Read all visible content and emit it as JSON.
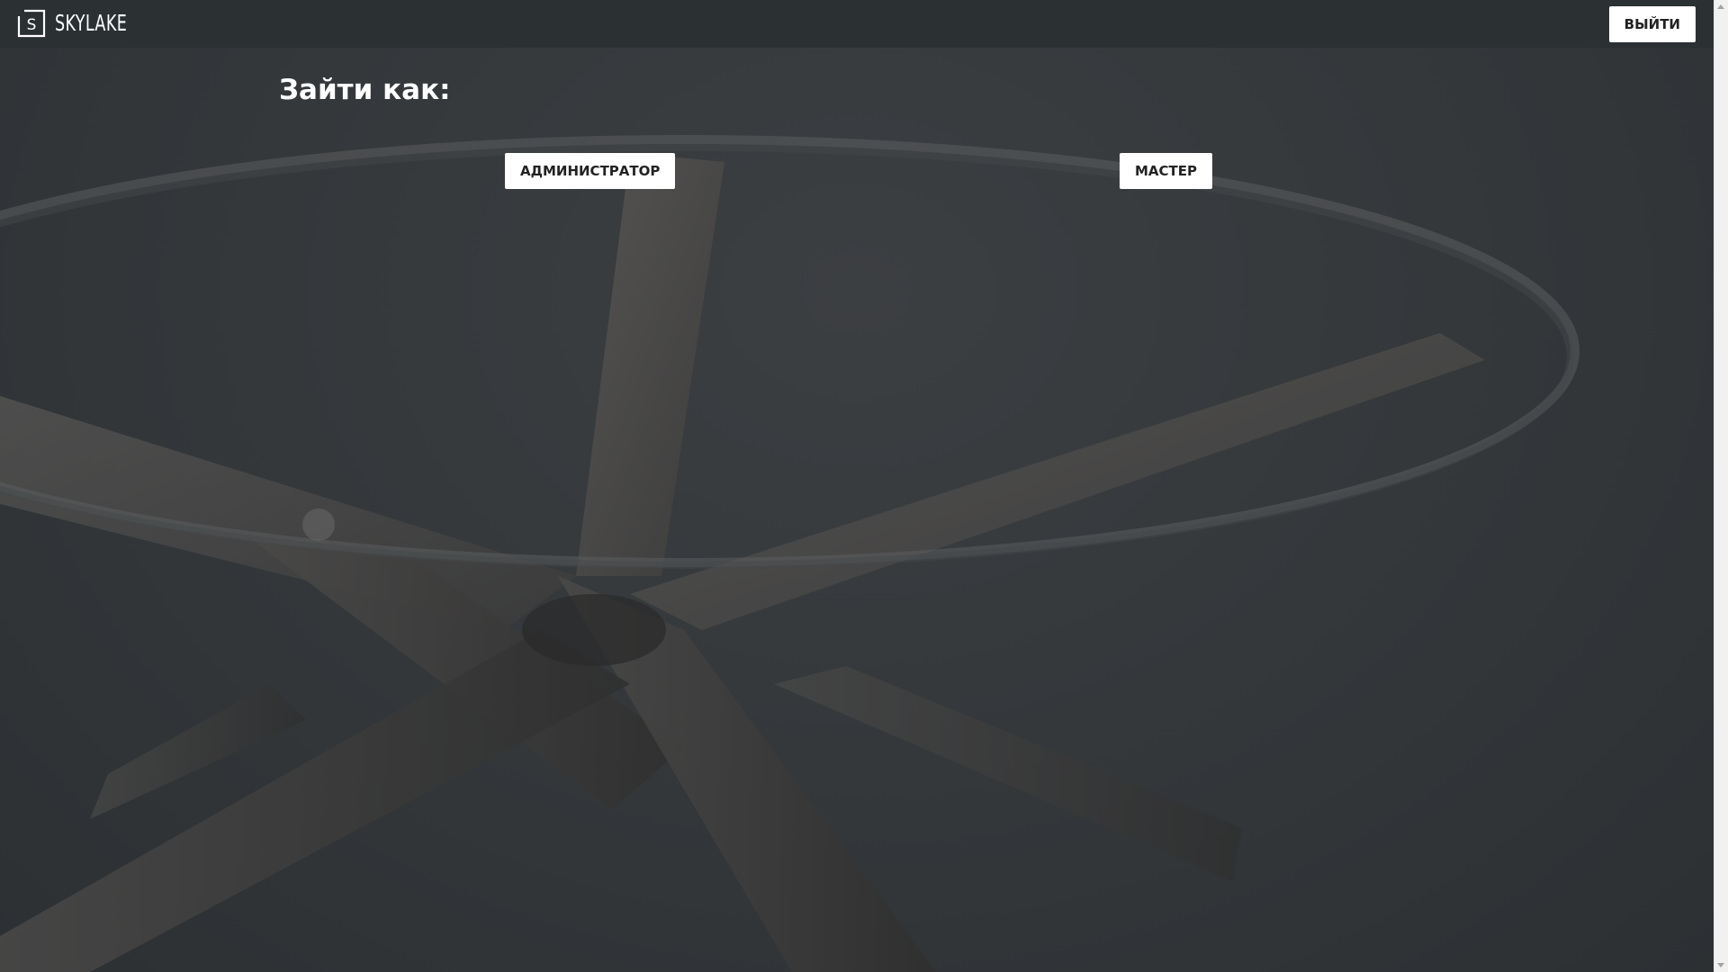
{
  "header": {
    "logo_letter": "S",
    "logo_text": "SKYLAKE",
    "logout_label": "ВЫЙТИ"
  },
  "main": {
    "title": "Зайти как:",
    "roles": {
      "admin_label": "АДМИНИСТРАТОР",
      "master_label": "МАСТЕР"
    }
  },
  "background": {
    "image": "glass-table-wooden-legs",
    "base_color": "#33373a"
  },
  "colors": {
    "topbar": "#2b3033",
    "button_bg": "#ffffff",
    "button_text": "#222222",
    "title_text": "#ffffff"
  }
}
